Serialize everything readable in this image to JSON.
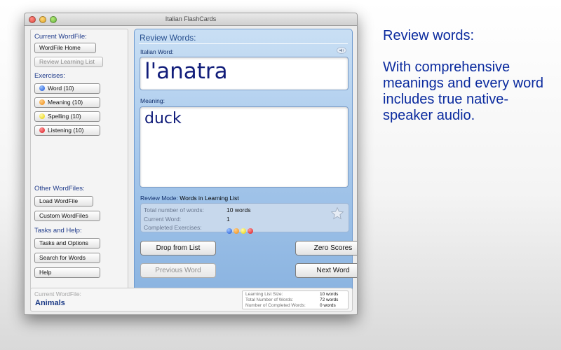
{
  "window": {
    "title": "Italian FlashCards"
  },
  "sidebar": {
    "current_wordfile_label": "Current WordFile:",
    "wordfile_home": "WordFile Home",
    "review_learning_list": "Review Learning List",
    "exercises_label": "Exercises:",
    "exercises": [
      {
        "label": "Word (10)",
        "color": "#1b52d6"
      },
      {
        "label": "Meaning (10)",
        "color": "#ee8a10"
      },
      {
        "label": "Spelling (10)",
        "color": "#e8d000"
      },
      {
        "label": "Listening (10)",
        "color": "#d8141c"
      }
    ],
    "other_wordfiles_label": "Other WordFiles:",
    "load_wordfile": "Load WordFile",
    "custom_wordfiles": "Custom WordFiles",
    "tasks_help_label": "Tasks and Help:",
    "tasks_options": "Tasks and Options",
    "search_words": "Search for Words",
    "help": "Help"
  },
  "review": {
    "title": "Review Words:",
    "italian_word_label": "Italian Word:",
    "italian_word": "l'anatra",
    "meaning_label": "Meaning:",
    "meaning": "duck",
    "review_mode_label": "Review Mode:",
    "review_mode_value": "Words in Learning List",
    "stats": {
      "total_label": "Total number of words:",
      "total_value": "10 words",
      "current_label": "Current Word:",
      "current_value": "1",
      "completed_label": "Completed Exercises:"
    },
    "buttons": {
      "drop": "Drop from List",
      "zero": "Zero Scores",
      "previous": "Previous Word",
      "next": "Next Word"
    }
  },
  "status": {
    "current_wordfile_label": "Current WordFile:",
    "current_wordfile": "Animals",
    "learning_list_size_label": "Learning List Size:",
    "learning_list_size": "10 words",
    "total_words_label": "Total Number of Words:",
    "total_words": "72 words",
    "completed_words_label": "Number of Completed Words:",
    "completed_words": "0 words"
  },
  "marketing": {
    "title": "Review words:",
    "body": "With comprehensive meanings and every word includes true native-speaker audio."
  },
  "colors": {
    "accent": "#1e3a8a",
    "panel": "#a8c9ec",
    "marketing_text": "#0a2a9e"
  }
}
